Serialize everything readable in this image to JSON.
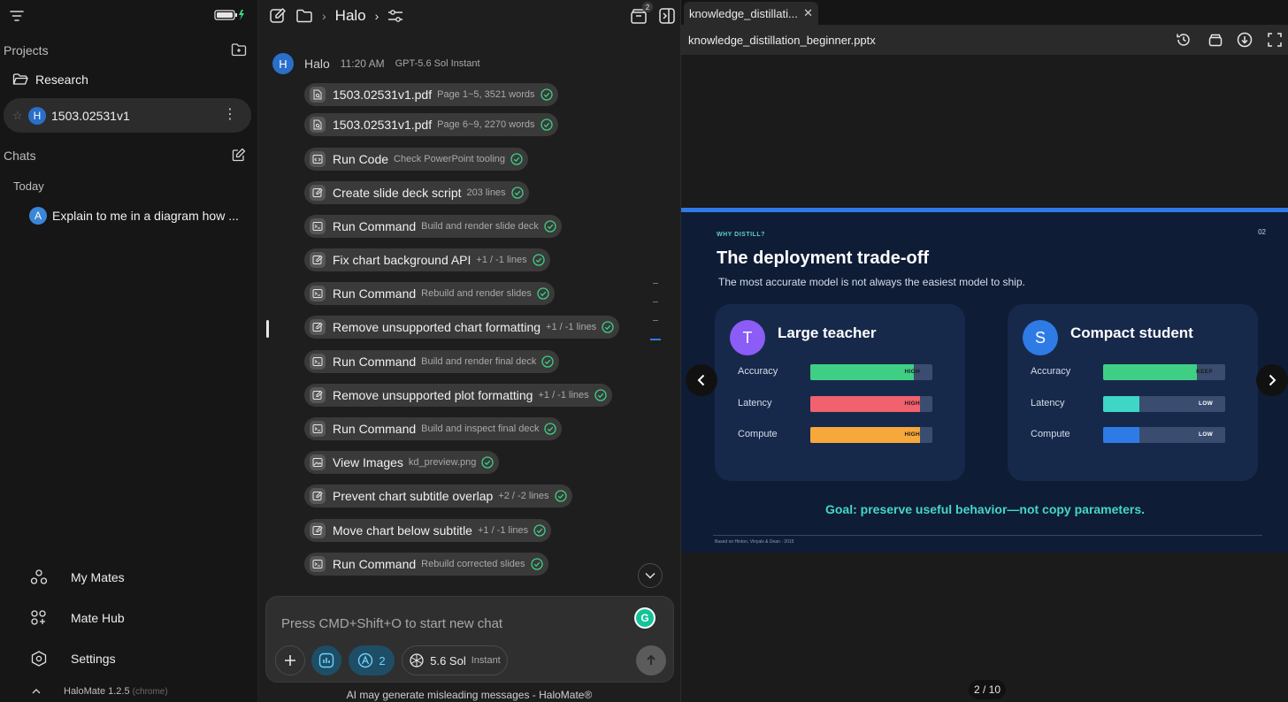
{
  "sidebar": {
    "projects_label": "Projects",
    "folder": "Research",
    "project_item": {
      "avatar": "H",
      "name": "1503.02531v1"
    },
    "chats_label": "Chats",
    "today_label": "Today",
    "chat_item": {
      "avatar": "A",
      "title": "Explain to me in a diagram how ..."
    },
    "nav": [
      {
        "label": "My Mates",
        "icon": "mates-icon"
      },
      {
        "label": "Mate Hub",
        "icon": "hub-icon"
      },
      {
        "label": "Settings",
        "icon": "settings-icon"
      }
    ],
    "version": "HaloMate 1.2.5",
    "version_tag": "(chrome)"
  },
  "chat": {
    "breadcrumb_title": "Halo",
    "badge_count": "2",
    "message": {
      "avatar": "H",
      "author": "Halo",
      "time": "11:20 AM",
      "model": "GPT-5.6 Sol Instant"
    },
    "steps": [
      {
        "label": "1503.02531v1.pdf",
        "detail": "Page 1~5, 3521 words",
        "icon": "document-search-icon"
      },
      {
        "label": "1503.02531v1.pdf",
        "detail": "Page 6~9, 2270 words",
        "icon": "document-search-icon"
      },
      {
        "label": "Run Code",
        "detail": "Check PowerPoint tooling",
        "icon": "code-icon"
      },
      {
        "label": "Create slide deck script",
        "detail": "203 lines",
        "icon": "edit-icon"
      },
      {
        "label": "Run Command",
        "detail": "Build and render slide deck",
        "icon": "terminal-icon"
      },
      {
        "label": "Fix chart background API",
        "detail": "+1 / -1 lines",
        "icon": "edit-icon"
      },
      {
        "label": "Run Command",
        "detail": "Rebuild and render slides",
        "icon": "terminal-icon"
      },
      {
        "label": "Remove unsupported chart formatting",
        "detail": "+1 / -1 lines",
        "icon": "edit-icon"
      },
      {
        "label": "Run Command",
        "detail": "Build and render final deck",
        "icon": "terminal-icon"
      },
      {
        "label": "Remove unsupported plot formatting",
        "detail": "+1 / -1 lines",
        "icon": "edit-icon"
      },
      {
        "label": "Run Command",
        "detail": "Build and inspect final deck",
        "icon": "terminal-icon"
      },
      {
        "label": "View Images",
        "detail": "kd_preview.png",
        "icon": "image-icon"
      },
      {
        "label": "Prevent chart subtitle overlap",
        "detail": "+2 / -2 lines",
        "icon": "edit-icon"
      },
      {
        "label": "Move chart below subtitle",
        "detail": "+1 / -1 lines",
        "icon": "edit-icon"
      },
      {
        "label": "Run Command",
        "detail": "Rebuild corrected slides",
        "icon": "terminal-icon"
      }
    ],
    "composer_placeholder": "Press CMD+Shift+O to start new chat",
    "agent_count": "2",
    "model_name": "5.6 Sol",
    "model_variant": "Instant",
    "disclaimer": "AI may generate misleading messages - HaloMate®"
  },
  "preview": {
    "tab_title": "knowledge_distillati...",
    "file_name": "knowledge_distillation_beginner.pptx",
    "page_indicator": "2 / 10",
    "slide": {
      "kicker": "WHY DISTILL?",
      "page": "02",
      "title": "The deployment trade-off",
      "subtitle": "The most accurate model is not always the easiest model to ship.",
      "cards": [
        {
          "avatar": "T",
          "avatar_color": "#8b5cf6",
          "title": "Large teacher",
          "metrics": [
            {
              "label": "Accuracy",
              "tag": "HIGH",
              "level": 0.85,
              "color": "#3fcf84"
            },
            {
              "label": "Latency",
              "tag": "HIGH",
              "level": 0.9,
              "color": "#f2616e"
            },
            {
              "label": "Compute",
              "tag": "HIGH",
              "level": 0.9,
              "color": "#f7a83a"
            }
          ]
        },
        {
          "avatar": "S",
          "avatar_color": "#2f7be6",
          "title": "Compact student",
          "metrics": [
            {
              "label": "Accuracy",
              "tag": "KEEP",
              "level": 0.77,
              "color": "#3fcf84"
            },
            {
              "label": "Latency",
              "tag": "LOW",
              "level": 0.3,
              "color": "#3fd6c6"
            },
            {
              "label": "Compute",
              "tag": "LOW",
              "level": 0.3,
              "color": "#2f7be6"
            }
          ]
        }
      ],
      "goal": "Goal: preserve useful behavior—not copy parameters.",
      "citation": "Based on Hinton, Vinyals & Dean · 2015"
    }
  }
}
